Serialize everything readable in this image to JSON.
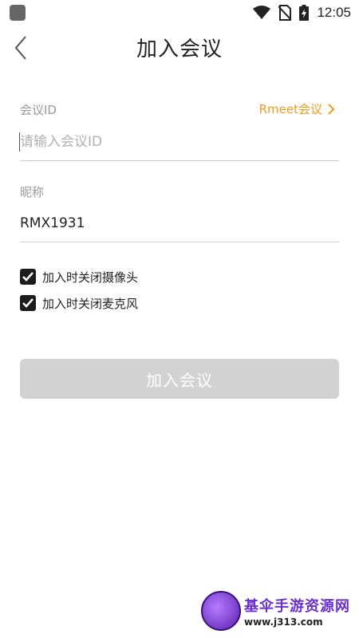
{
  "status_bar": {
    "time": "12:05",
    "icons": [
      "app-icon",
      "wifi-icon",
      "no-sim-icon",
      "battery-icon"
    ]
  },
  "header": {
    "title": "加入会议",
    "back_icon": "chevron-left-icon"
  },
  "meeting_id": {
    "label": "会议ID",
    "link_label": "Rmeet会议",
    "placeholder": "请输入会议ID",
    "value": ""
  },
  "nickname": {
    "label": "昵称",
    "value": "RMX1931"
  },
  "options": [
    {
      "label": "加入时关闭摄像头",
      "checked": true
    },
    {
      "label": "加入时关闭麦克风",
      "checked": true
    }
  ],
  "join_button": {
    "label": "加入会议",
    "enabled": false
  },
  "watermark": {
    "title": "基伞手游资源网",
    "url": "www.j313.com"
  },
  "colors": {
    "accent_link": "#f09a1b",
    "button_disabled": "#d2d2d2",
    "checkbox": "#1c1c1c"
  }
}
